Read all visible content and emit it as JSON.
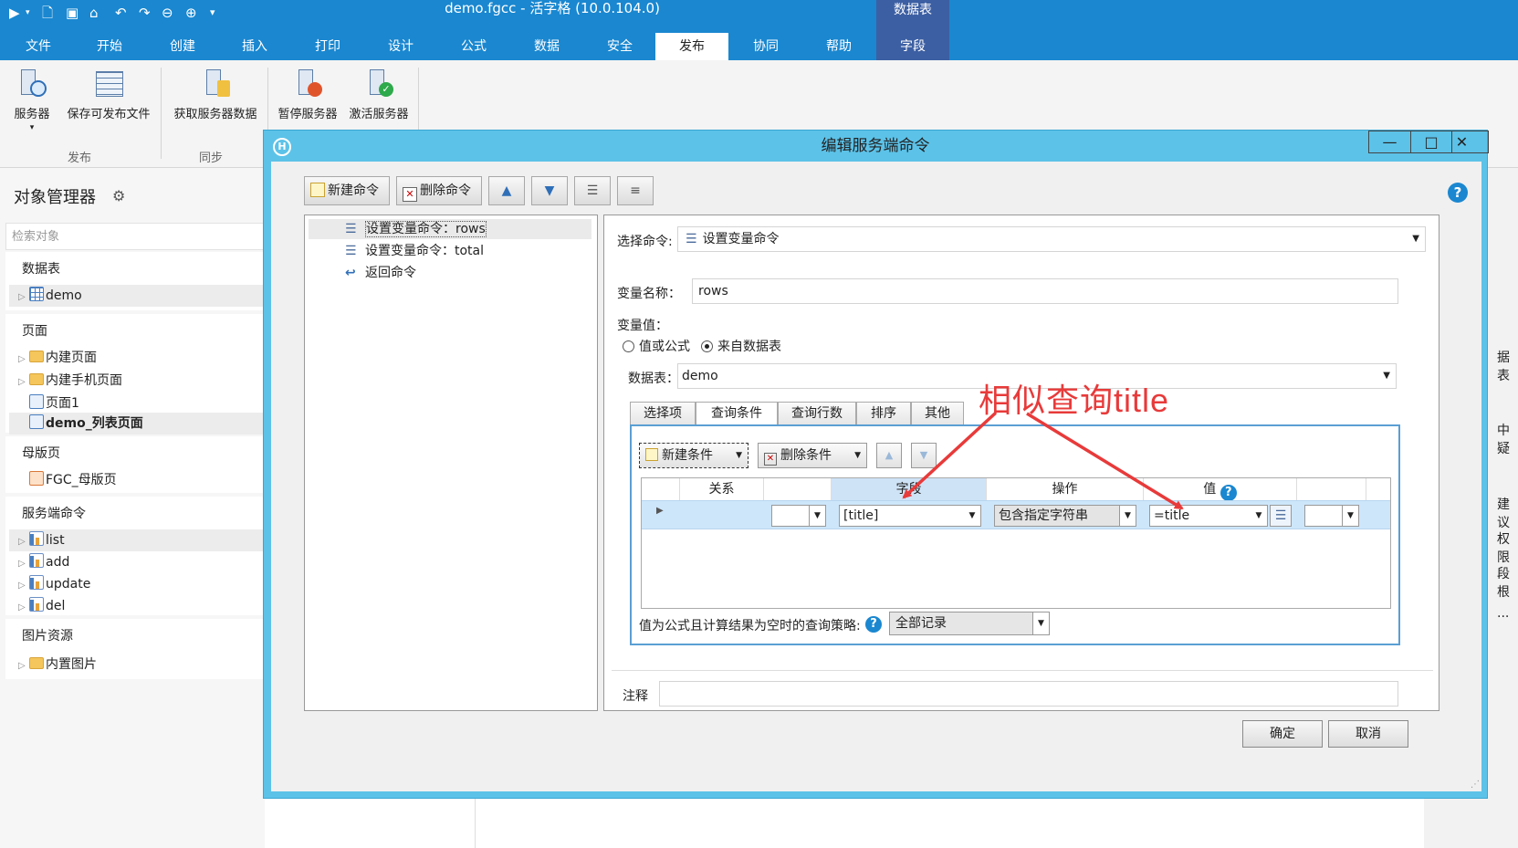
{
  "app": {
    "title": "demo.fgcc - 活字格 (10.0.104.0)",
    "context_header": "数据表",
    "quick_access_icons": [
      "run-icon",
      "new-icon",
      "save-icon",
      "open-icon",
      "undo-icon",
      "redo-icon",
      "back-icon",
      "forward-icon",
      "customize-icon"
    ]
  },
  "ribbon_tabs": [
    {
      "label": "文件"
    },
    {
      "label": "开始"
    },
    {
      "label": "创建"
    },
    {
      "label": "插入"
    },
    {
      "label": "打印"
    },
    {
      "label": "设计"
    },
    {
      "label": "公式"
    },
    {
      "label": "数据"
    },
    {
      "label": "安全"
    },
    {
      "label": "发布",
      "active": true
    },
    {
      "label": "协同"
    },
    {
      "label": "帮助"
    },
    {
      "label": "字段"
    }
  ],
  "ribbon": {
    "buttons": [
      "服务器",
      "保存可发布文件",
      "获取服务器数据",
      "暂停服务器",
      "激活服务器"
    ],
    "groups": [
      "发布",
      "同步"
    ]
  },
  "object_manager": {
    "title": "对象管理器",
    "search_placeholder": "检索对象",
    "sections": [
      {
        "title": "数据表",
        "items": [
          {
            "label": "demo",
            "icon": "table-icon"
          }
        ]
      },
      {
        "title": "页面",
        "items": [
          {
            "label": "内建页面",
            "icon": "folder-icon"
          },
          {
            "label": "内建手机页面",
            "icon": "folder-icon"
          },
          {
            "label": "页面1",
            "icon": "page-icon"
          },
          {
            "label": "demo_列表页面",
            "icon": "page-icon",
            "bold": true
          }
        ]
      },
      {
        "title": "母版页",
        "items": [
          {
            "label": "FGC_母版页",
            "icon": "master-page-icon"
          }
        ]
      },
      {
        "title": "服务端命令",
        "items": [
          {
            "label": "list",
            "icon": "command-icon"
          },
          {
            "label": "add",
            "icon": "command-icon"
          },
          {
            "label": "update",
            "icon": "command-icon"
          },
          {
            "label": "del",
            "icon": "command-icon"
          }
        ]
      },
      {
        "title": "图片资源",
        "items": [
          {
            "label": "内置图片",
            "icon": "folder-icon"
          }
        ]
      }
    ]
  },
  "right_strip": [
    "据表",
    "中疑",
    "建议",
    "权限",
    "段根",
    "..."
  ],
  "dialog": {
    "title": "编辑服务端命令",
    "toolbar": {
      "new_command": "新建命令",
      "delete_command": "删除命令"
    },
    "commands": [
      {
        "label": "设置变量命令：rows",
        "selected": true
      },
      {
        "label": "设置变量命令：total"
      },
      {
        "label": "返回命令"
      }
    ],
    "select_command_label": "选择命令:",
    "select_command_value": "设置变量命令",
    "var_name_label": "变量名称：",
    "var_name_value": "rows",
    "var_value_label": "变量值：",
    "radio_formula": "值或公式",
    "radio_table": "来自数据表",
    "table_label": "数据表：",
    "table_value": "demo",
    "tabs": [
      {
        "label": "选择项"
      },
      {
        "label": "查询条件",
        "active": true
      },
      {
        "label": "查询行数"
      },
      {
        "label": "排序"
      },
      {
        "label": "其他"
      }
    ],
    "new_condition": "新建条件",
    "delete_condition": "删除条件",
    "grid_headers": {
      "relation": "关系",
      "field": "字段",
      "operation": "操作",
      "value": "值"
    },
    "grid_row": {
      "field": "[title]",
      "operation": "包含指定字符串",
      "value": "=title"
    },
    "strategy_label": "值为公式且计算结果为空时的查询策略:",
    "strategy_value": "全部记录",
    "remark_label": "注释",
    "ok": "确定",
    "cancel": "取消"
  },
  "annotation": "相似查询title",
  "colors": {
    "ribbon_blue": "#1a87d0",
    "context_tab": "#3c5fa3",
    "dialog_frame": "#5cc2e8",
    "annotation_red": "#e83a3a",
    "selected_row": "#cde6fa"
  }
}
